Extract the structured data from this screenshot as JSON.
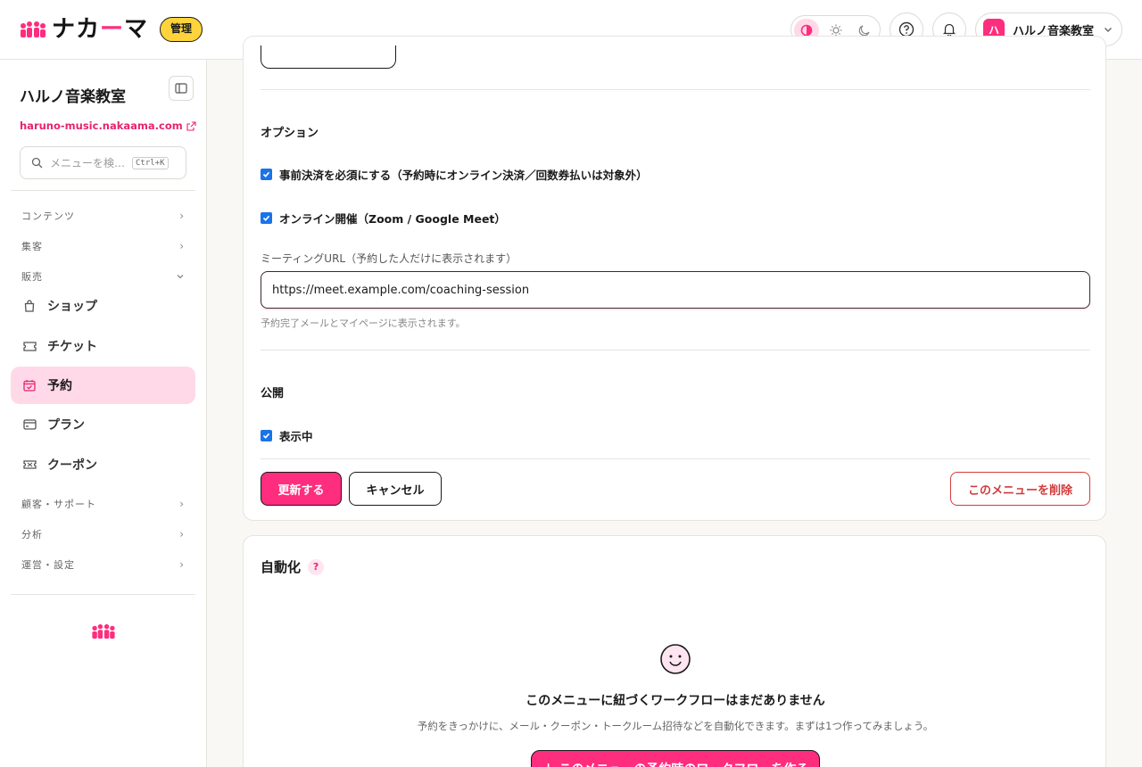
{
  "header": {
    "logo_text_main": "ナカ",
    "logo_text_accent": "ー",
    "logo_text_end": "マ",
    "admin_badge": "管理",
    "theme_modes": [
      "contrast",
      "light",
      "dark"
    ],
    "active_theme": "contrast",
    "account": {
      "avatar_letter": "ハ",
      "name": "ハルノ音楽教室"
    },
    "brand_color": "#ff2d7e"
  },
  "sidebar": {
    "site_name": "ハルノ音楽教室",
    "site_url": "haruno-music.nakaama.com",
    "search": {
      "placeholder": "メニューを検…",
      "shortcut": "Ctrl+K"
    },
    "groups": {
      "contents": "コンテンツ",
      "marketing": "集客",
      "sales": "販売",
      "customers": "顧客・サポート",
      "analytics": "分析",
      "operations": "運営・設定"
    },
    "items": {
      "shop": "ショップ",
      "ticket": "チケット",
      "reservation": "予約",
      "plan": "プラン",
      "coupon": "クーポン"
    },
    "active_item": "予約"
  },
  "form": {
    "options_heading": "オプション",
    "prepay_label": "事前決済を必須にする（予約時にオンライン決済／回数券払いは対象外）",
    "prepay_checked": true,
    "online_label": "オンライン開催（Zoom / Google Meet）",
    "online_checked": true,
    "meeting_url_label": "ミーティングURL（予約した人だけに表示されます）",
    "meeting_url_value": "https://meet.example.com/coaching-session",
    "meeting_url_help": "予約完了メールとマイページに表示されます。",
    "publish_heading": "公開",
    "visible_label": "表示中",
    "visible_checked": true,
    "update_button": "更新する",
    "cancel_button": "キャンセル",
    "delete_button": "このメニューを削除"
  },
  "automation": {
    "title": "自動化",
    "help_icon": "?",
    "empty_title": "このメニューに紐づくワークフローはまだありません",
    "empty_desc": "予約をきっかけに、メール・クーポン・トークルーム招待などを自動化できます。まずは1つ作ってみましょう。",
    "create_button": "＋ このメニューの予約時のワークフローを作る"
  }
}
